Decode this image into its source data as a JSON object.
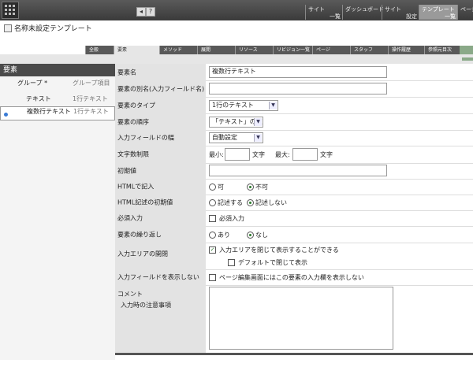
{
  "topbar": {
    "help_label": "?",
    "nav": [
      {
        "line1": "サイト",
        "line2": "一覧"
      },
      {
        "line1": "ダッシュボード",
        "line2": ""
      },
      {
        "line1": "サイト",
        "line2": "設定"
      },
      {
        "line1": "テンプレート",
        "line2": "一覧"
      },
      {
        "line1": "ページ",
        "line2": ""
      }
    ]
  },
  "title": "名称未設定テンプレート",
  "tabs": [
    "全般",
    "要素",
    "メソッド",
    "展開",
    "リソース",
    "リビジョン一覧",
    "ページ",
    "スタッフ",
    "操作履歴",
    "参照元目次"
  ],
  "sidebar": {
    "header": "要素",
    "rows": [
      {
        "name": "グループ *",
        "type": "グループ項目"
      },
      {
        "name": "テキスト",
        "type": "1行テキスト"
      },
      {
        "name": "複数行テキスト",
        "type": "1行テキスト"
      }
    ]
  },
  "form": {
    "element_name": {
      "label": "要素名",
      "value": "複数行テキスト"
    },
    "alias": {
      "label": "要素の別名(入力フィールド名)",
      "value": ""
    },
    "type": {
      "label": "要素のタイプ",
      "value": "1行のテキスト"
    },
    "order": {
      "label": "要素の順序",
      "value": "「テキスト」の次"
    },
    "width": {
      "label": "入力フィールドの幅",
      "value": "自動設定"
    },
    "charlimit": {
      "label": "文字数制限",
      "min_label": "最小:",
      "max_label": "最大:",
      "unit": "文字",
      "min": "",
      "max": ""
    },
    "initial": {
      "label": "初期値",
      "value": ""
    },
    "html_input": {
      "label": "HTMLで記入",
      "opt1": "可",
      "opt2": "不可"
    },
    "html_default": {
      "label": "HTML記述の初期値",
      "opt1": "記述する",
      "opt2": "記述しない"
    },
    "required": {
      "label": "必須入力",
      "option": "必須入力"
    },
    "repeat": {
      "label": "要素の繰り返し",
      "opt1": "あり",
      "opt2": "なし"
    },
    "area_toggle": {
      "label": "入力エリアの開閉",
      "option1": "入力エリアを閉じて表示することができる",
      "option2": "デフォルトで閉じて表示"
    },
    "hide_field": {
      "label": "入力フィールドを表示しない",
      "option": "ページ編集画面にはこの要素の入力欄を表示しない"
    },
    "comment": {
      "label": "コメント",
      "sublabel": "入力時の注意事項",
      "value": ""
    }
  }
}
